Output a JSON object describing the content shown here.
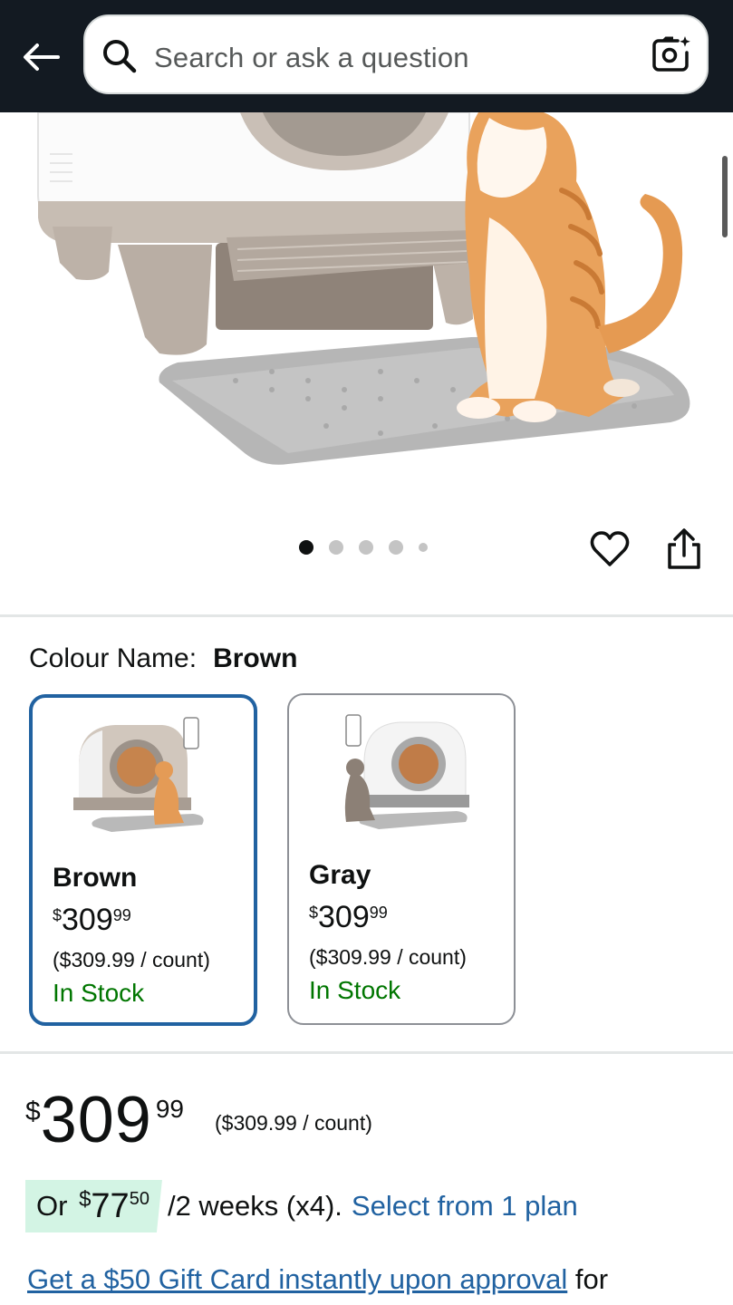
{
  "header": {
    "search_placeholder": "Search or ask a question"
  },
  "gallery": {
    "image_count": 5,
    "active_index": 0
  },
  "variation": {
    "label": "Colour Name:",
    "selected": "Brown",
    "options": [
      {
        "name": "Brown",
        "price_currency": "$",
        "price_whole": "309",
        "price_fraction": "99",
        "unit_price": "($309.99 / count)",
        "stock": "In Stock"
      },
      {
        "name": "Gray",
        "price_currency": "$",
        "price_whole": "309",
        "price_fraction": "99",
        "unit_price": "($309.99 / count)",
        "stock": "In Stock"
      }
    ]
  },
  "price": {
    "currency": "$",
    "whole": "309",
    "fraction": "99",
    "unit_price": "($309.99 / count)"
  },
  "installment": {
    "prefix": "Or",
    "currency": "$",
    "whole": "77",
    "fraction": "50",
    "terms": "/2 weeks (x4).",
    "link": "Select from 1 plan"
  },
  "gift_card": {
    "link": "Get a $50 Gift Card instantly upon approval",
    "suffix": "for"
  },
  "colors": {
    "header_bg": "#131a22",
    "link": "#2162a1",
    "in_stock": "#007600",
    "selected_border": "#2162a1",
    "plan_chip": "#d3f4e4"
  },
  "icons": [
    "back-arrow-icon",
    "search-icon",
    "camera-search-icon",
    "heart-icon",
    "share-icon"
  ]
}
